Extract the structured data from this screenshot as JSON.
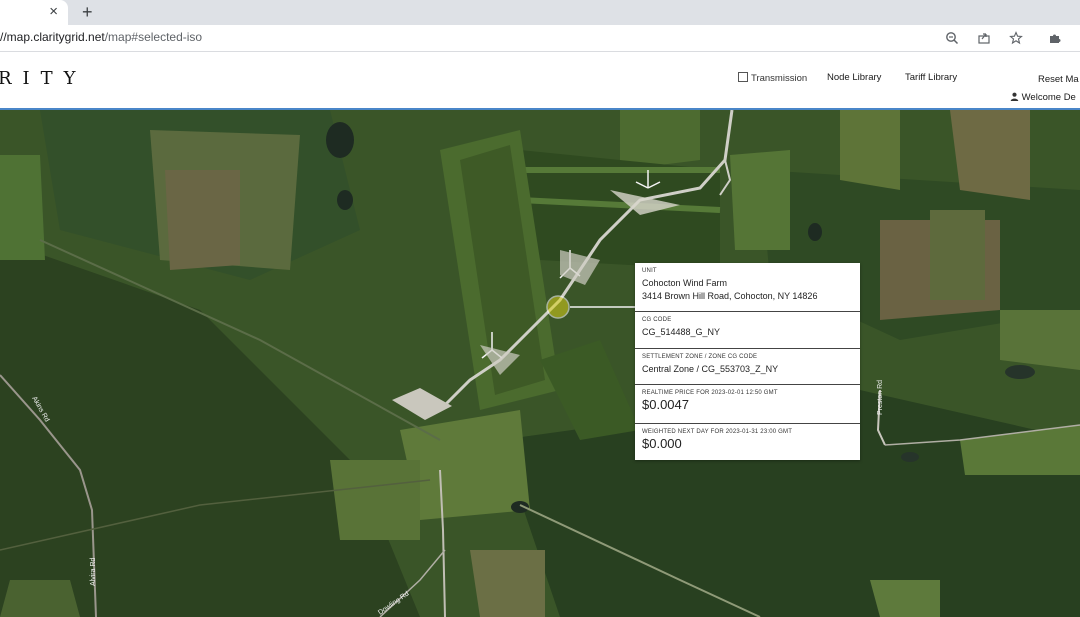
{
  "browser": {
    "tab_close": "×",
    "new_tab": "+",
    "url_main": "//map.claritygrid.net",
    "url_path": "/map#selected-iso"
  },
  "header": {
    "logo_text": "RITY",
    "transmission_label": "Transmission",
    "node_library_label": "Node Library",
    "tariff_library_label": "Tariff Library",
    "reset_label": "Reset Ma",
    "welcome_label": "Welcome De"
  },
  "map": {
    "roads": {
      "alvira": "Alvira Rd",
      "preston": "Preston Rd",
      "akins": "Akins Rd",
      "dowling": "Dowling Rd"
    }
  },
  "info_panel": {
    "unit_label": "UNIT",
    "unit_name": "Cohocton Wind Farm",
    "unit_address": "3414 Brown Hill Road, Cohocton, NY 14826",
    "cg_code_label": "CG CODE",
    "cg_code": "CG_514488_G_NY",
    "zone_label": "SETTLEMENT ZONE / ZONE CG CODE",
    "zone_value": "Central Zone / CG_553703_Z_NY",
    "realtime_label": "REALTIME PRICE FOR 2023-02-01 12:50 GMT",
    "realtime_value": "$0.0047",
    "nextday_label": "WEIGHTED NEXT DAY FOR 2023-01-31 23:00 GMT",
    "nextday_value": "$0.000"
  },
  "colors": {
    "accent_line": "#4a86c8",
    "forest": "#2e4a22",
    "field": "#5a7a3a"
  }
}
